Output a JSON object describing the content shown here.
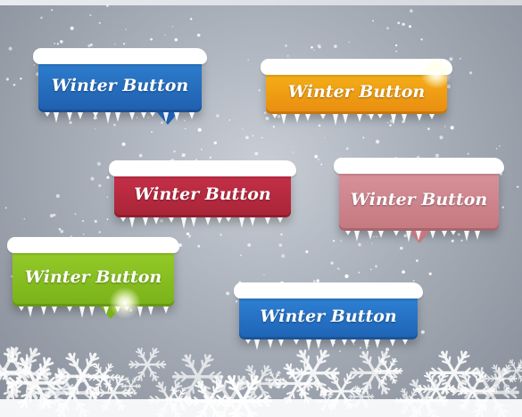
{
  "buttons": [
    {
      "label": "Winter Button",
      "color": "#2f7fd0",
      "color2": "#1f5fae",
      "has_tail": true,
      "has_glare": false
    },
    {
      "label": "Winter Button",
      "color": "#f5b218",
      "color2": "#e98c10",
      "has_tail": false,
      "has_glare": true
    },
    {
      "label": "Winter Button",
      "color": "#c7314a",
      "color2": "#a82437",
      "has_tail": false,
      "has_glare": false
    },
    {
      "label": "Winter Button",
      "color": "#d9939c",
      "color2": "#c57880",
      "has_tail": true,
      "has_glare": false
    },
    {
      "label": "Winter Button",
      "color": "#96cc2a",
      "color2": "#79b219",
      "has_tail": true,
      "has_glare": true
    },
    {
      "label": "Winter Button",
      "color": "#2f83d6",
      "color2": "#1e63b5",
      "has_tail": false,
      "has_glare": false
    }
  ],
  "icons": {
    "snowflake": "snowflake-icon",
    "icicle": "icicle-icon",
    "glare": "light-glare-icon"
  }
}
